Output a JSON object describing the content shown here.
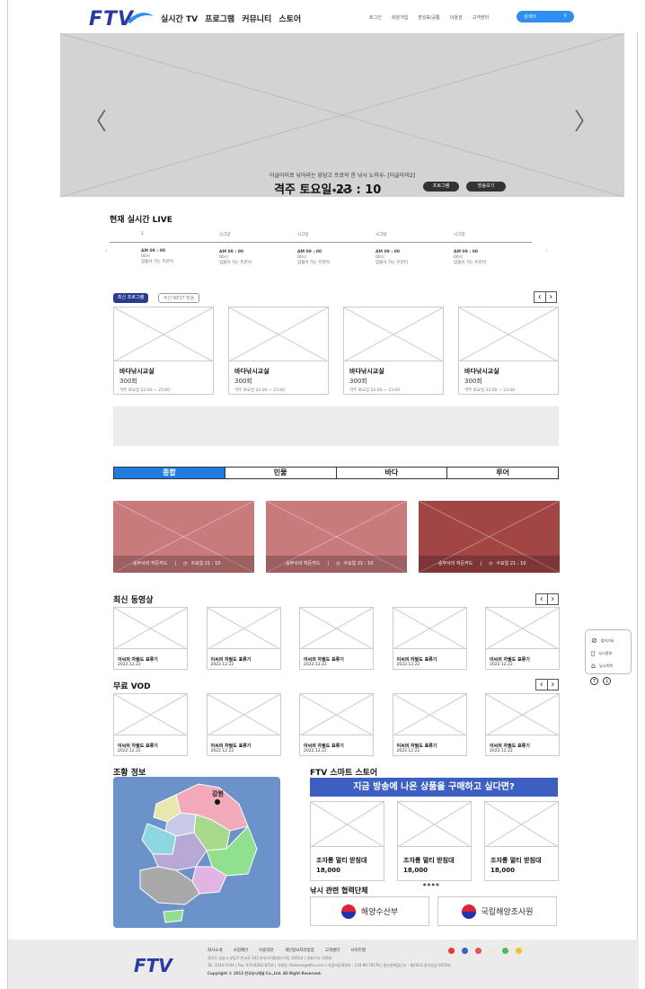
{
  "header": {
    "logo": "FTV",
    "main_nav": [
      "실시간 TV",
      "프로그램",
      "커뮤니티",
      "스토어"
    ],
    "top_nav": [
      "로그인",
      "회원가입",
      "편성표/공통",
      "이용권",
      "고객센터"
    ],
    "search_placeholder": "검색어",
    "search_icon": "search-icon"
  },
  "hero": {
    "subtitle": "이글아이로 낚아라는 당당고 프로의 한 낚시 노하우- [이글아이2]",
    "title": "격주 토요일 23 : 10",
    "program_btn": "프로그램",
    "watch_btn": "방송보기",
    "dots": "● ● ● ●",
    "prev": "〈",
    "next": "〉"
  },
  "live": {
    "title": "현재 실시간 LIVE",
    "channels": [
      {
        "name": "1",
        "time": "AM 09 : 00",
        "info": "00시",
        "desc": "입돌이 가는 트분이"
      },
      {
        "name": "시그널",
        "time": "AM 09 : 00",
        "info": "00시",
        "desc": "입돌이 가는 트분이"
      },
      {
        "name": "시그널",
        "time": "AM 09 : 00",
        "info": "00시",
        "desc": "입돌이 가는 트분이"
      },
      {
        "name": "시그널",
        "time": "AM 09 : 00",
        "info": "00시",
        "desc": "입돌이 가는 트분이"
      },
      {
        "name": "시그널",
        "time": "AM 09 : 00",
        "info": "00시",
        "desc": "입돌이 가는 트분이"
      }
    ]
  },
  "programs": {
    "tab_active": "최신 프로그램",
    "tab_inactive": "주간 BEST 방송",
    "items": [
      {
        "title": "바다낚시교실",
        "episode": "300회",
        "time": "격주 화요일 22:00 ~ 23:00"
      },
      {
        "title": "바다낚시교실",
        "episode": "300회",
        "time": "격주 화요일 22:00 ~ 23:00"
      },
      {
        "title": "바다낚시교실",
        "episode": "300회",
        "time": "격주 화요일 22:00 ~ 23:00"
      },
      {
        "title": "바다낚시교실",
        "episode": "300회",
        "time": "격주 화요일 22:00 ~ 23:00"
      }
    ]
  },
  "category_tabs": [
    "종합",
    "민물",
    "바다",
    "루어"
  ],
  "featured": [
    {
      "name": "승부사의 히든카드",
      "time": "수요일 21 : 10",
      "color": "#c97a7a"
    },
    {
      "name": "승부사의 히든카드",
      "time": "수요일 21 : 10",
      "color": "#c97a7a"
    },
    {
      "name": "승부사의 히든카드",
      "time": "수요일 21 : 10",
      "color": "#a24545"
    }
  ],
  "latest_videos": {
    "title": "최신 동영상",
    "items": [
      {
        "title": "이씨의 자필도 표류기",
        "date": "2022.12.22"
      },
      {
        "title": "이씨의 자필도 표류기",
        "date": "2022.12.22"
      },
      {
        "title": "이씨의 자필도 표류기",
        "date": "2022.12.22"
      },
      {
        "title": "이씨의 자필도 표류기",
        "date": "2022.12.22"
      },
      {
        "title": "이씨의 자필도 표류기",
        "date": "2022.12.22"
      }
    ]
  },
  "free_vod": {
    "title": "무료 VOD",
    "items": [
      {
        "title": "이씨의 자필도 표류기",
        "date": "2022.12.22"
      },
      {
        "title": "이씨의 자필도 표류기",
        "date": "2022.12.22"
      },
      {
        "title": "이씨의 자필도 표류기",
        "date": "2022.12.22"
      },
      {
        "title": "이씨의 자필도 표류기",
        "date": "2022.12.22"
      },
      {
        "title": "이씨의 자필도 표류기",
        "date": "2022.12.22"
      }
    ]
  },
  "side_menu": [
    "점어기요",
    "낚시정보",
    "낚시독백"
  ],
  "fishing_info": {
    "title": "조황 정보",
    "region": "강원"
  },
  "store": {
    "title": "FTV 스마트 스토어",
    "banner": "지금 방송에 나온 상품을 구매하고 싶다면?",
    "products": [
      {
        "name": "조자룡 멀티 받침대",
        "price": "18,000"
      },
      {
        "name": "조자룡 멀티 받침대",
        "price": "18,000"
      },
      {
        "name": "조자룡 멀티 받침대",
        "price": "18,000"
      }
    ],
    "dots": "● ● ● ●"
  },
  "partners": {
    "title": "낚시 관련 협력단체",
    "items": [
      "해양수산부",
      "국립해양조사원"
    ]
  },
  "footer": {
    "logo": "FTV",
    "links": [
      "회사소개",
      "사업제안",
      "이용약관",
      "개인정보처리방침",
      "고객센터",
      "사이트맵"
    ],
    "address": "경기도 성남시 분당구 판교로 242 판교디지털센터 A동 1001호 | 대표이사 나명재",
    "contact": "Tel. 1544-5744 | Fax. 070-8282-8716 | 이메일. ftvkorea@eftv.co.kr | 사업자등록번호 : 119-86-79576 | 통신판매업신고 : 제2013-경기성남-1670호",
    "copyright": "Copyright © 2013 한국낚시채널 Co.,Ltd. All Right Reserved.",
    "sns_colors": [
      "#e23a3a",
      "#3b5fc4",
      "#e05555",
      "#f3e9c8",
      "#55b755",
      "#f0c419"
    ]
  }
}
